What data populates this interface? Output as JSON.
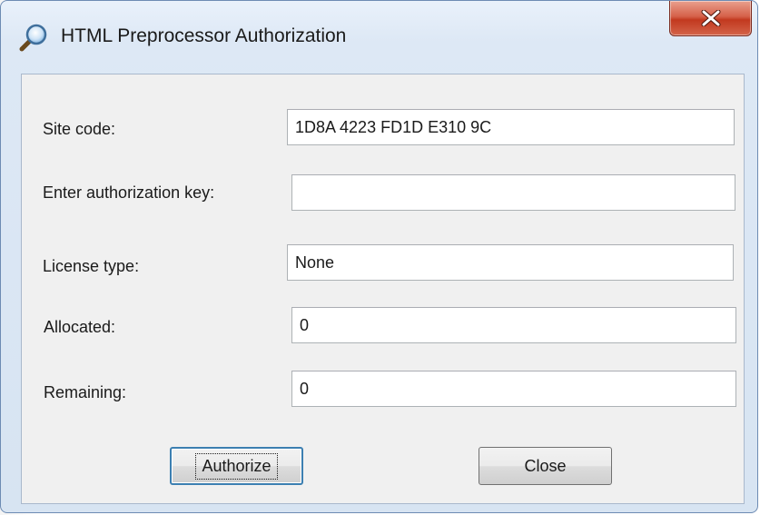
{
  "window": {
    "title": "HTML Preprocessor Authorization",
    "close_glyph": "X"
  },
  "form": {
    "site_code": {
      "label": "Site code:",
      "value": "1D8A 4223 FD1D E310 9C"
    },
    "auth_key": {
      "label": "Enter authorization key:",
      "value": "",
      "placeholder": ""
    },
    "license_type": {
      "label": "License type:",
      "value": "None"
    },
    "allocated": {
      "label": "Allocated:",
      "value": "0"
    },
    "remaining": {
      "label": "Remaining:",
      "value": "0"
    }
  },
  "buttons": {
    "authorize": "Authorize",
    "close": "Close"
  },
  "icons": {
    "app": "magnifier-icon",
    "close": "close-icon"
  },
  "colors": {
    "close_button": "#c2391f",
    "default_button_border": "#3c7fb1",
    "window_frame": "#d7e4f2",
    "client_bg": "#f0f0f0"
  }
}
